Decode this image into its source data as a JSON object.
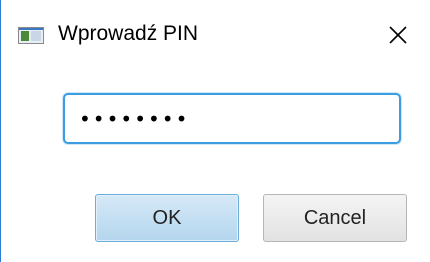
{
  "window": {
    "title": "Wprowadź PIN",
    "app_icon": "window-app-icon",
    "close_icon": "close-icon"
  },
  "pin_field": {
    "value": "••••••••",
    "type": "password"
  },
  "buttons": {
    "ok_label": "OK",
    "cancel_label": "Cancel"
  },
  "colors": {
    "focus_border": "#3c9ee0",
    "ok_button": "#b4d6ee",
    "cancel_button": "#e2e2e2"
  }
}
